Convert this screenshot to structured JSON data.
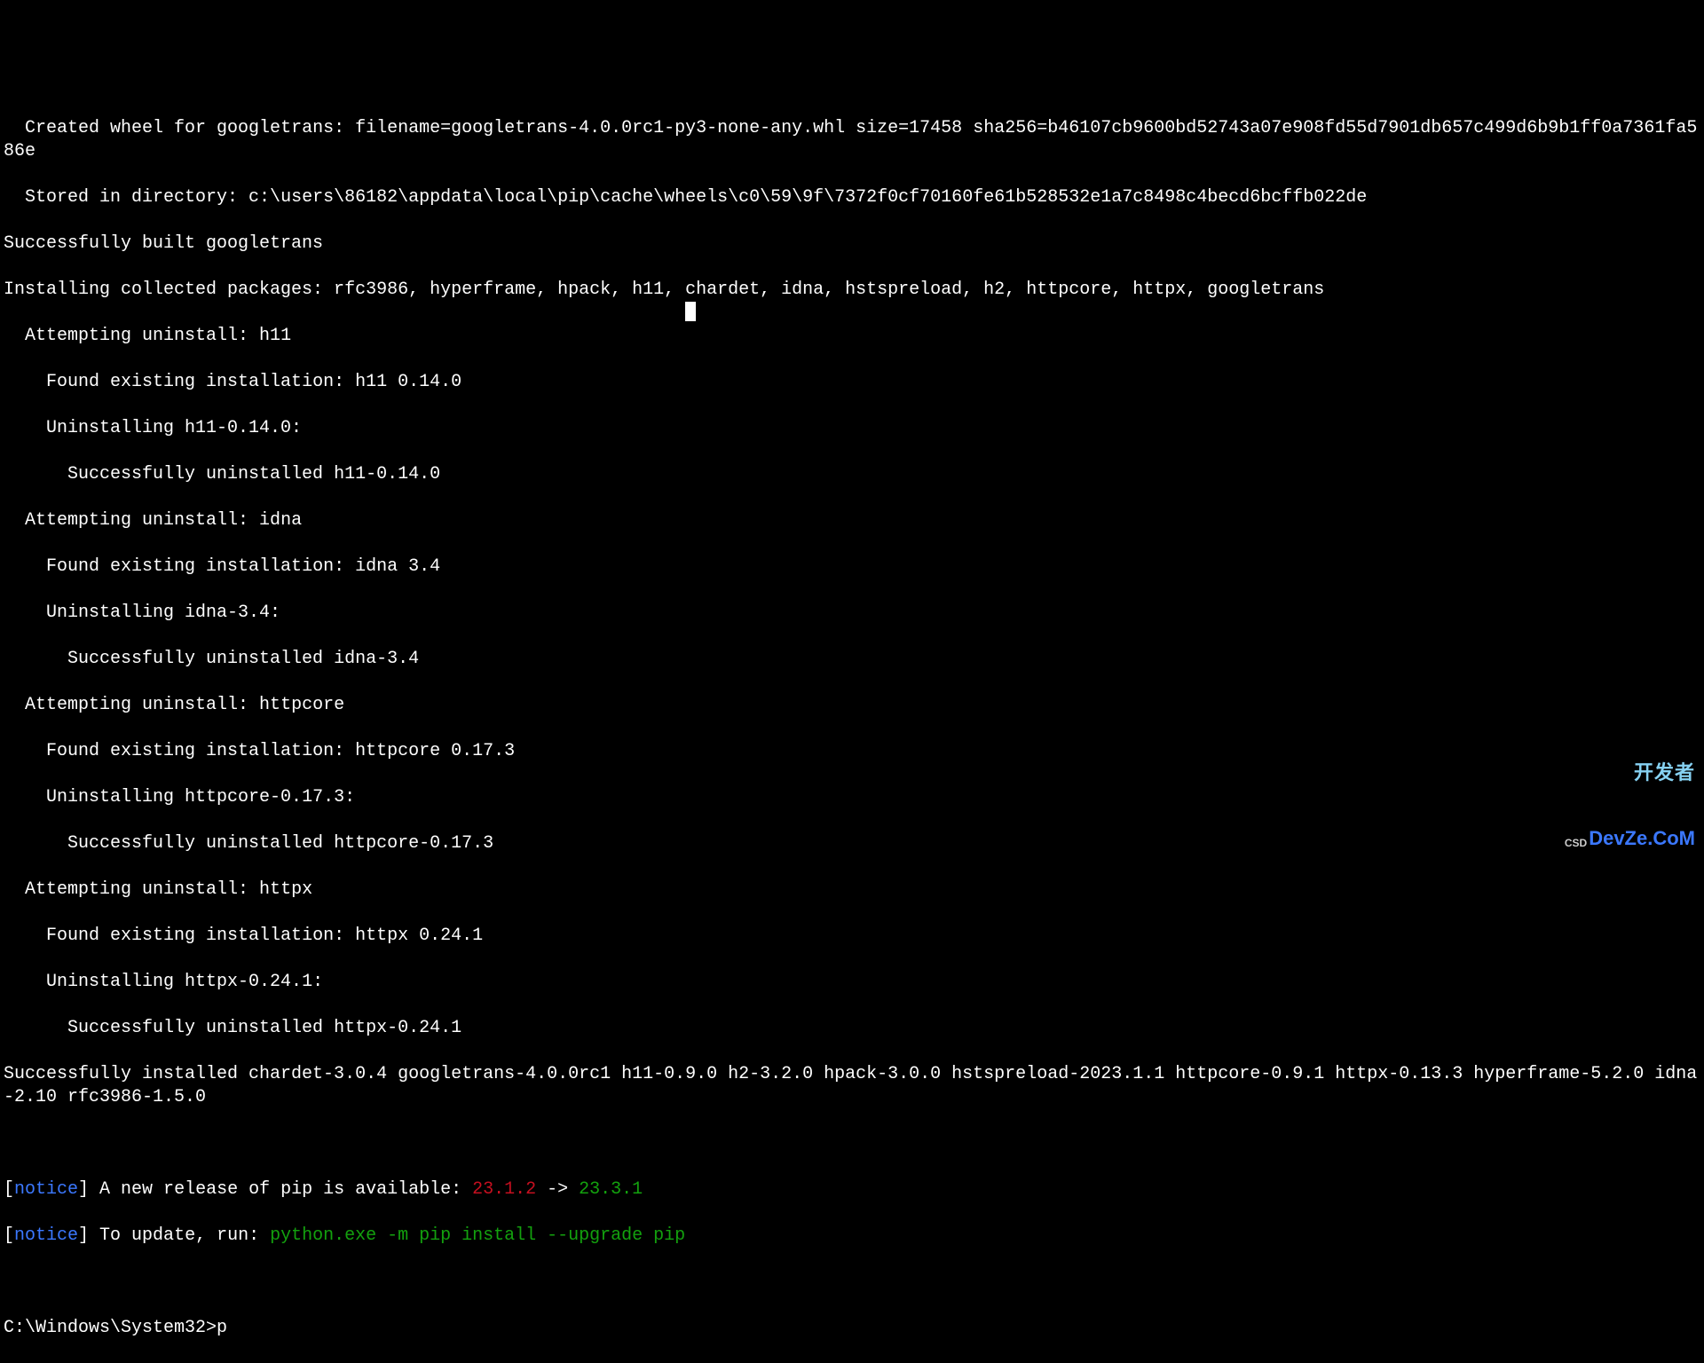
{
  "terminal": {
    "lines": {
      "l1": "  Created wheel for googletrans: filename=googletrans-4.0.0rc1-py3-none-any.whl size=17458 sha256=b46107cb9600bd52743a07e908fd55d7901db657c499d6b9b1ff0a7361fa586e",
      "l2": "  Stored in directory: c:\\users\\86182\\appdata\\local\\pip\\cache\\wheels\\c0\\59\\9f\\7372f0cf70160fe61b528532e1a7c8498c4becd6bcffb022de",
      "l3": "Successfully built googletrans",
      "l4": "Installing collected packages: rfc3986, hyperframe, hpack, h11, chardet, idna, hstspreload, h2, httpcore, httpx, googletrans",
      "l5": "  Attempting uninstall: h11",
      "l6": "    Found existing installation: h11 0.14.0",
      "l7": "    Uninstalling h11-0.14.0:",
      "l8": "      Successfully uninstalled h11-0.14.0",
      "l9": "  Attempting uninstall: idna",
      "l10": "    Found existing installation: idna 3.4",
      "l11": "    Uninstalling idna-3.4:",
      "l12": "      Successfully uninstalled idna-3.4",
      "l13": "  Attempting uninstall: httpcore",
      "l14": "    Found existing installation: httpcore 0.17.3",
      "l15": "    Uninstalling httpcore-0.17.3:",
      "l16": "      Successfully uninstalled httpcore-0.17.3",
      "l17": "  Attempting uninstall: httpx",
      "l18": "    Found existing installation: httpx 0.24.1",
      "l19": "    Uninstalling httpx-0.24.1:",
      "l20": "      Successfully uninstalled httpx-0.24.1",
      "l21": "Successfully installed chardet-3.0.4 googletrans-4.0.0rc1 h11-0.9.0 h2-3.2.0 hpack-3.0.0 hstspreload-2023.1.1 httpcore-0.9.1 httpx-0.13.3 hyperframe-5.2.0 idna-2.10 rfc3986-1.5.0"
    },
    "notice1": {
      "bracket_open": "[",
      "tag": "notice",
      "bracket_close": "]",
      "text_before": " A new release of pip is available: ",
      "old_version": "23.1.2",
      "arrow": " -> ",
      "new_version": "23.3.1"
    },
    "notice2": {
      "bracket_open": "[",
      "tag": "notice",
      "bracket_close": "]",
      "text_before": " To update, run: ",
      "cmd": "python.exe -m pip install --upgrade pip"
    },
    "prompt": {
      "path": "C:\\Windows\\System32>",
      "input": "p"
    }
  },
  "watermark": {
    "prefix": "CSD",
    "top": "开发者",
    "bottom": "DevZe.CoM"
  }
}
